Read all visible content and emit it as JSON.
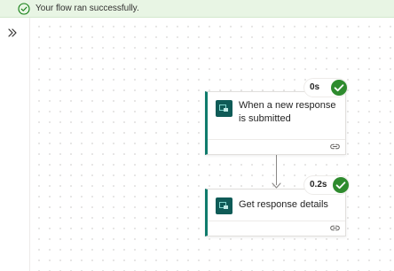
{
  "banner": {
    "message": "Your flow ran successfully.",
    "icon": "check-circle-icon",
    "color": "#107c10"
  },
  "sidebar": {
    "expand_icon": "double-chevron-right-icon"
  },
  "steps": [
    {
      "title": "When a new response is submitted",
      "duration": "0s",
      "status_icon": "success-check-icon",
      "app_icon": "forms-icon"
    },
    {
      "title": "Get response details",
      "duration": "0.2s",
      "status_icon": "success-check-icon",
      "app_icon": "forms-icon"
    }
  ],
  "colors": {
    "success": "#2e8b2e",
    "accent": "#0f7b6c",
    "banner_bg": "#e8f5e4"
  }
}
